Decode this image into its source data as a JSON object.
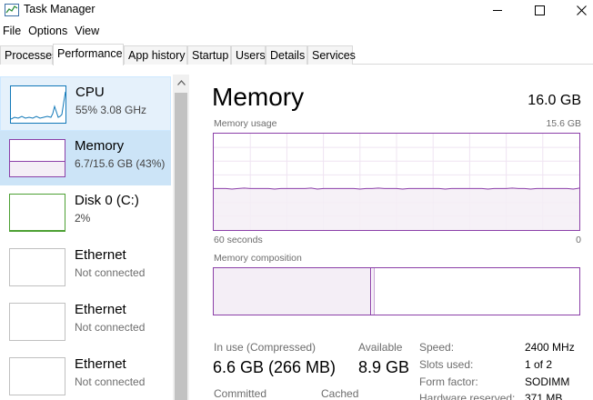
{
  "window": {
    "title": "Task Manager",
    "icon": "task-manager-icon",
    "controls": [
      "minimize-icon",
      "maximize-icon",
      "close-icon"
    ]
  },
  "menu": [
    "File",
    "Options",
    "View"
  ],
  "tabs": [
    {
      "label": "Processes",
      "active": false
    },
    {
      "label": "Performance",
      "active": true
    },
    {
      "label": "App history",
      "active": false
    },
    {
      "label": "Startup",
      "active": false
    },
    {
      "label": "Users",
      "active": false
    },
    {
      "label": "Details",
      "active": false
    },
    {
      "label": "Services",
      "active": false
    }
  ],
  "sidebar": {
    "items": [
      {
        "title": "CPU",
        "subtitle": "55%  3.08 GHz",
        "graph_color": "#1178b8",
        "state": "hover"
      },
      {
        "title": "Memory",
        "subtitle": "6.7/15.6 GB (43%)",
        "graph_color": "#8b3fa8",
        "state": "selected"
      },
      {
        "title": "Disk 0 (C:)",
        "subtitle": "2%",
        "graph_color": "#4da033",
        "state": "normal"
      },
      {
        "title": "Ethernet",
        "subtitle": "Not connected",
        "graph_color": "#c0c0c0",
        "state": "normal"
      },
      {
        "title": "Ethernet",
        "subtitle": "Not connected",
        "graph_color": "#c0c0c0",
        "state": "normal"
      },
      {
        "title": "Ethernet",
        "subtitle": "Not connected",
        "graph_color": "#c0c0c0",
        "state": "normal"
      }
    ]
  },
  "memory": {
    "title": "Memory",
    "total": "16.0 GB",
    "usage_label": "Memory usage",
    "usage_max": "15.6 GB",
    "time_left": "60 seconds",
    "time_right": "0",
    "usage_fraction": 0.43,
    "composition_label": "Memory composition",
    "composition_in_use_fraction": 0.43,
    "accent_color": "#8b3fa8",
    "in_use_label": "In use (Compressed)",
    "in_use_value": "6.6 GB (266 MB)",
    "available_label": "Available",
    "available_value": "8.9 GB",
    "committed_label": "Committed",
    "cached_label": "Cached",
    "specs": [
      {
        "label": "Speed:",
        "value": "2400 MHz"
      },
      {
        "label": "Slots used:",
        "value": "1 of 2"
      },
      {
        "label": "Form factor:",
        "value": "SODIMM"
      },
      {
        "label": "Hardware reserved:",
        "value": "371 MB"
      }
    ]
  }
}
